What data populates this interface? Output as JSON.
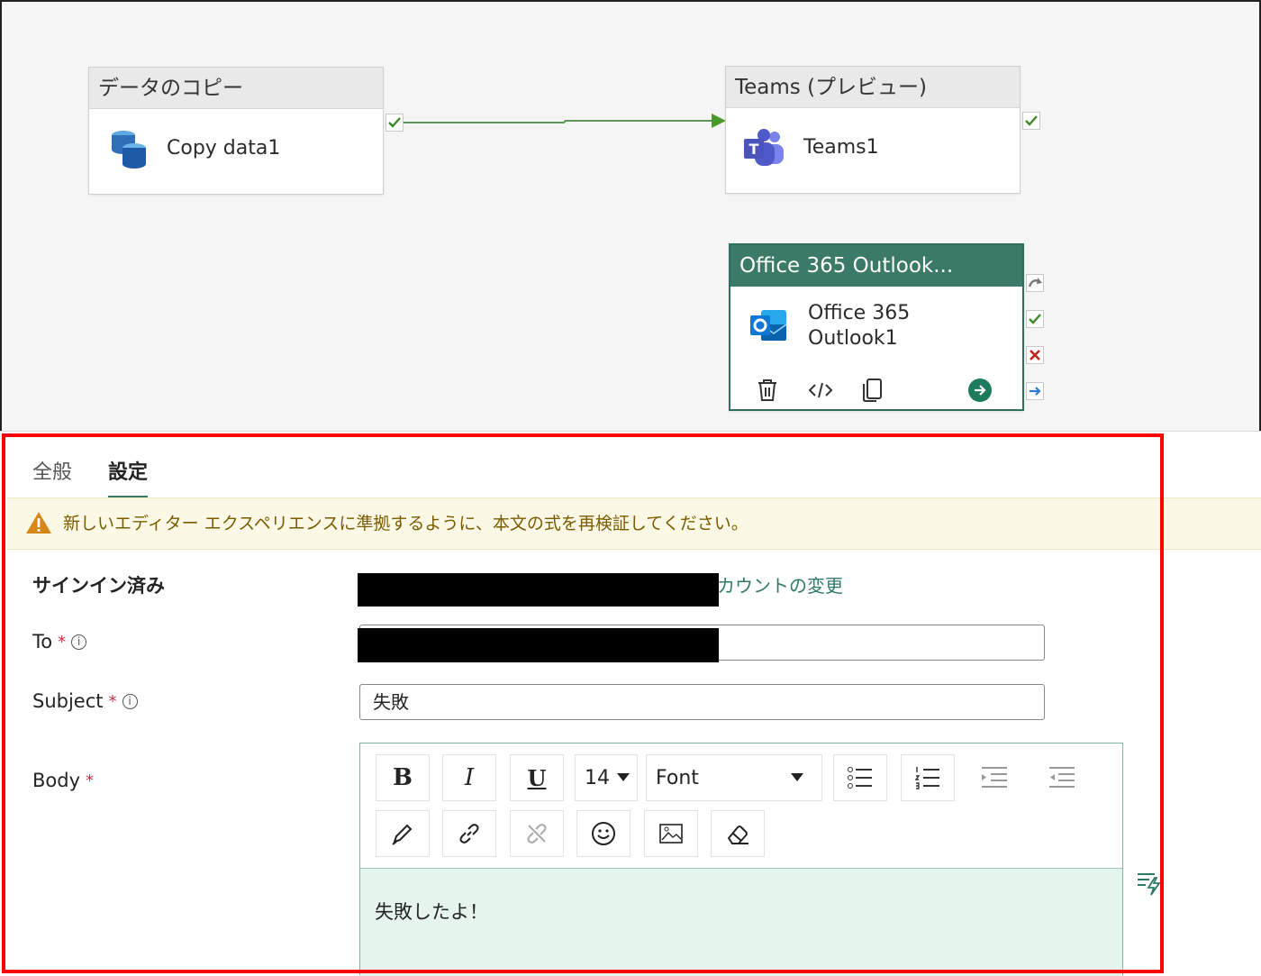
{
  "canvas": {
    "copy_node": {
      "header": "データのコピー",
      "name": "Copy data1"
    },
    "teams_node": {
      "header": "Teams (プレビュー)",
      "name": "Teams1"
    },
    "outlook_node": {
      "header": "Office 365 Outlook...",
      "name_line1": "Office 365",
      "name_line2": "Outlook1"
    }
  },
  "tabs": [
    {
      "label": "全般"
    },
    {
      "label": "設定"
    }
  ],
  "banner": {
    "text": "新しいエディター エクスペリエンスに準拠するように、本文の式を再検証してください。"
  },
  "form": {
    "signed_in": {
      "label": "サインイン済み",
      "change_link": "カウントの変更"
    },
    "to": {
      "label": "To",
      "required": "*",
      "info": "i"
    },
    "subject": {
      "label": "Subject",
      "required": "*",
      "info": "i",
      "value": "失敗"
    },
    "body": {
      "label": "Body",
      "required": "*",
      "value": "失敗したよ！"
    }
  },
  "toolbar": {
    "font_size": "14",
    "font": "Font",
    "bold": "B",
    "italic": "I",
    "underline": "U"
  },
  "colors": {
    "accent": "#3b7a66",
    "success": "#4a9a2a",
    "failure": "#c4314b",
    "skip": "#2f7bd1",
    "highlight_frame": "#ff0000"
  },
  "icons": [
    "database-icon",
    "teams-icon",
    "outlook-icon",
    "check-icon",
    "skip-icon",
    "fail-icon",
    "complete-icon",
    "delete-icon",
    "code-icon",
    "copy-icon",
    "go-icon",
    "warning-icon",
    "bullets-icon",
    "numbered-list-icon",
    "indent-icon",
    "outdent-icon",
    "pen-icon",
    "link-icon",
    "unlink-icon",
    "emoji-icon",
    "image-icon",
    "eraser-icon",
    "dynamic-content-icon"
  ]
}
